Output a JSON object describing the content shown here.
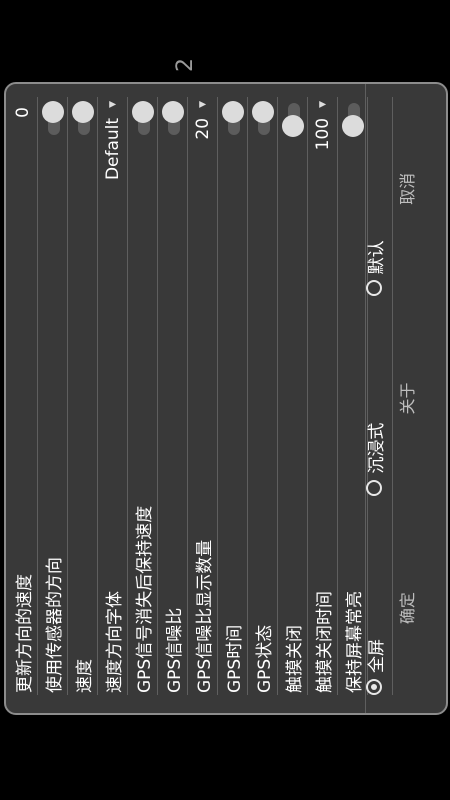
{
  "page_number": "2",
  "settings": [
    {
      "label": "更新方向的速度",
      "value": "0",
      "control": "value"
    },
    {
      "label": "使用传感器的方向",
      "control": "toggle",
      "on": true
    },
    {
      "label": "速度",
      "control": "toggle",
      "on": true
    },
    {
      "label": "速度方向字体",
      "value": "Default",
      "control": "select"
    },
    {
      "label": "GPS信号消失后保持速度",
      "control": "toggle",
      "on": true
    },
    {
      "label": "GPS信噪比",
      "control": "toggle",
      "on": true
    },
    {
      "label": "GPS信噪比显示数量",
      "value": "20",
      "control": "select"
    },
    {
      "label": "GPS时间",
      "control": "toggle",
      "on": true
    },
    {
      "label": "GPS状态",
      "control": "toggle",
      "on": true
    },
    {
      "label": "触摸关闭",
      "control": "toggle",
      "on": false
    },
    {
      "label": "触摸关闭时间",
      "value": "100",
      "control": "select"
    },
    {
      "label": "保持屏幕常亮",
      "control": "toggle",
      "on": false
    }
  ],
  "mode_options": [
    {
      "label": "全屏",
      "checked": true
    },
    {
      "label": "沉浸式",
      "checked": false
    },
    {
      "label": "默认",
      "checked": false
    }
  ],
  "buttons": {
    "ok": "确定",
    "about": "关于",
    "cancel": "取消"
  },
  "colors": {
    "dialog_bg": "#393939",
    "border": "#8c8c8c",
    "knob": "#dcdcdc",
    "track": "#5c5c5c"
  }
}
